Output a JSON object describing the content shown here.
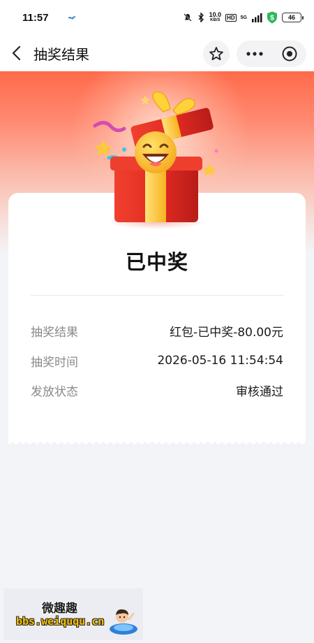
{
  "status_bar": {
    "time": "11:57",
    "net_speed": "10.0",
    "net_speed_unit": "KB/S",
    "hd_badge": "HD",
    "network": "5G",
    "battery": "46",
    "icons": [
      "bird-icon",
      "mute-icon",
      "bluetooth-icon",
      "signal-icon",
      "shield-icon",
      "battery-icon"
    ]
  },
  "nav": {
    "title": "抽奖结果",
    "icons": [
      "back-icon",
      "star-icon",
      "more-icon",
      "close-circle-icon"
    ]
  },
  "result": {
    "title": "已中奖",
    "rows": [
      {
        "label": "抽奖结果",
        "value": "红包-已中奖-80.00元"
      },
      {
        "label": "抽奖时间",
        "value": "2026-05-16 11:54:54"
      },
      {
        "label": "发放状态",
        "value": "审核通过"
      }
    ]
  },
  "watermark": {
    "cn": "微趣趣",
    "url": "bbs.weiququ.cn"
  },
  "colors": {
    "hero_top": "#ff6a4a",
    "page_bg": "#f3f4f8",
    "shield_green": "#2eb85c",
    "gift_red": "#e8352a",
    "ribbon_gold": "#ffc93c"
  }
}
